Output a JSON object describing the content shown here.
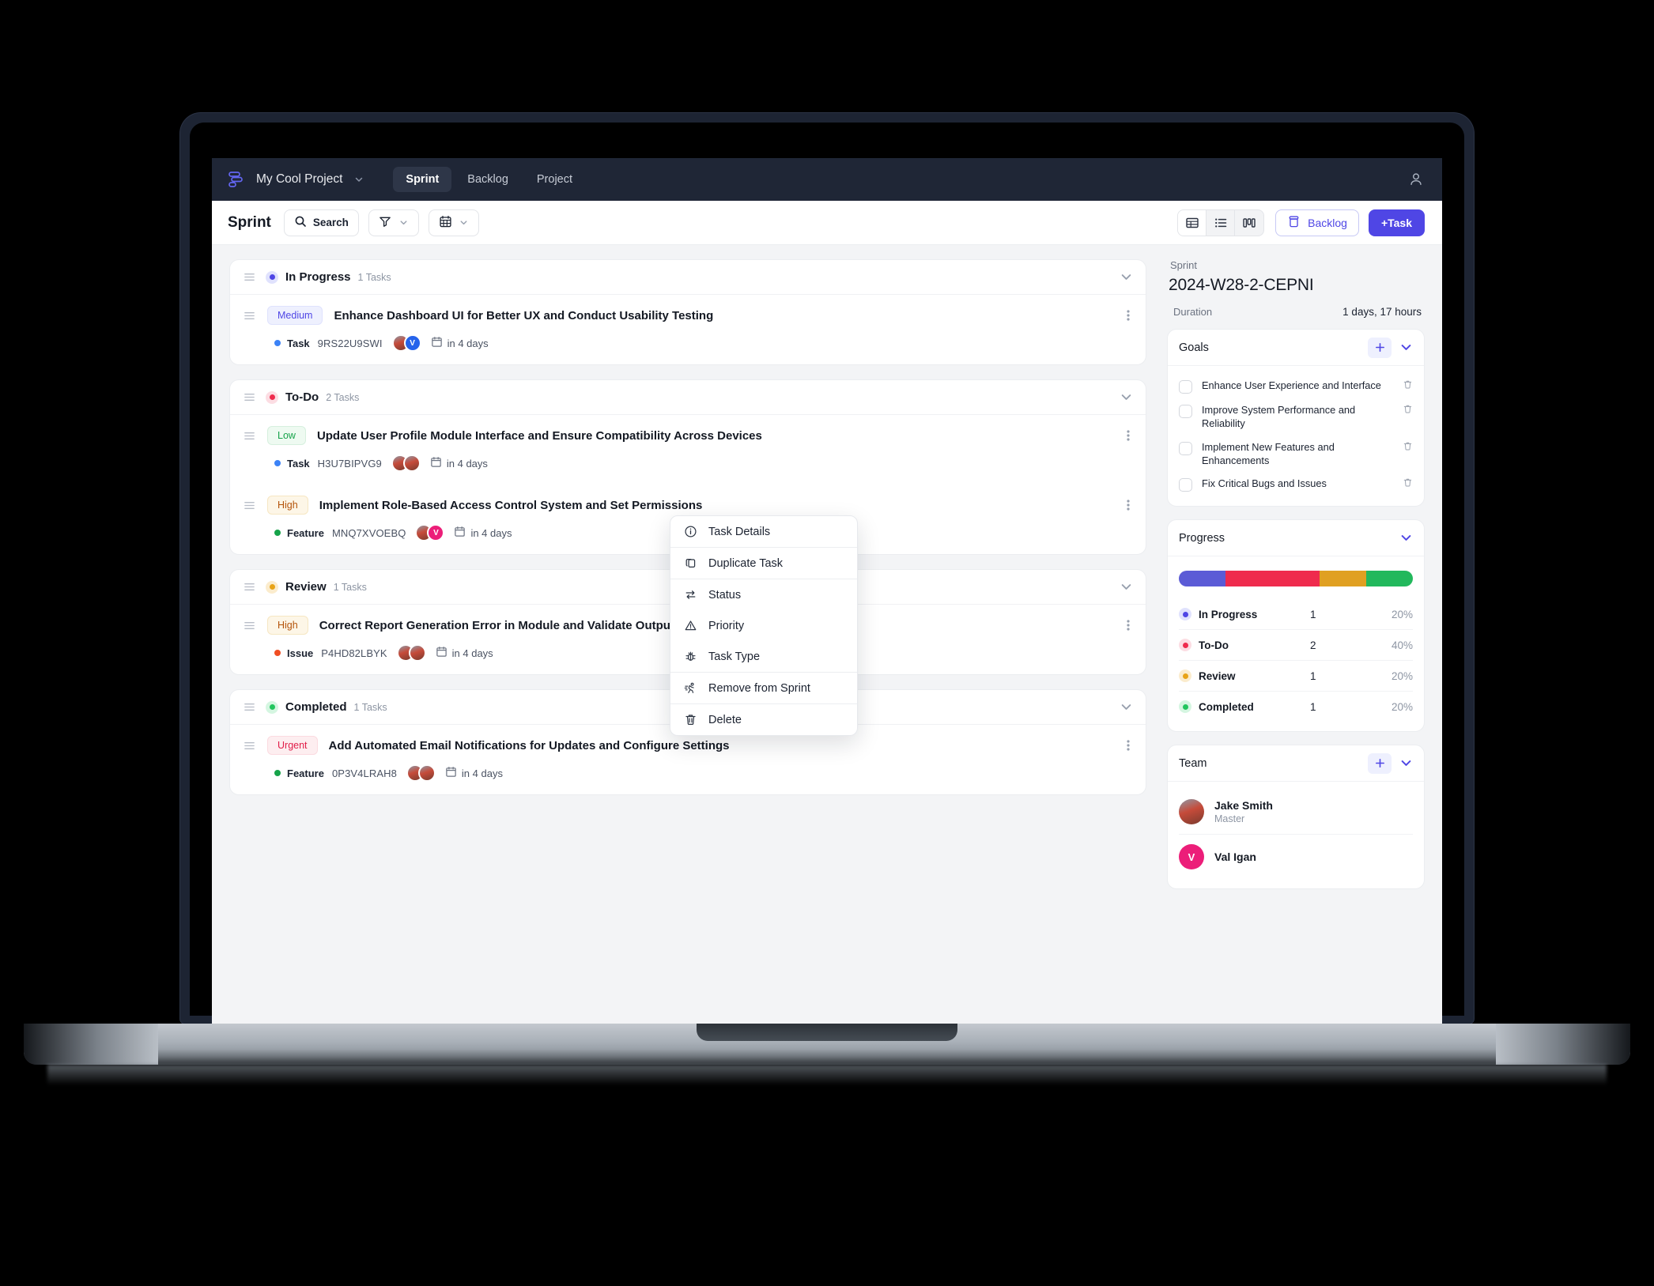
{
  "topbar": {
    "logo": "app-logo",
    "project_name": "My Cool Project",
    "nav": [
      {
        "label": "Sprint",
        "active": true
      },
      {
        "label": "Backlog",
        "active": false
      },
      {
        "label": "Project",
        "active": false
      }
    ],
    "user_icon": "user-icon"
  },
  "toolbar": {
    "title": "Sprint",
    "search_label": "Search",
    "filter_icon": "filter-icon",
    "calendar_icon": "calendar-icon",
    "views": [
      {
        "icon": "table-view-icon",
        "active": true
      },
      {
        "icon": "list-view-icon",
        "active": false
      },
      {
        "icon": "board-view-icon",
        "active": false
      }
    ],
    "backlog_label": "Backlog",
    "add_task_label": "+Task"
  },
  "groups": [
    {
      "name": "In Progress",
      "count_label": "1 Tasks",
      "color": "#4f46e5",
      "ring": "#e0e2fd",
      "tasks": [
        {
          "priority": "Medium",
          "priority_class": "medium",
          "title": "Enhance Dashboard UI for Better UX and Conduct Usability Testing",
          "type": "Task",
          "type_color": "#3b82f6",
          "id": "9RS22U9SWI",
          "avatars": [
            {
              "kind": "photo",
              "initial": ""
            },
            {
              "kind": "initial",
              "initial": "V",
              "color": "#2563eb"
            }
          ],
          "due": "in 4 days"
        }
      ]
    },
    {
      "name": "To-Do",
      "count_label": "2 Tasks",
      "color": "#ef2b4d",
      "ring": "#fcdde3",
      "tasks": [
        {
          "priority": "Low",
          "priority_class": "low",
          "title": "Update User Profile Module Interface and Ensure Compatibility Across Devices",
          "type": "Task",
          "type_color": "#3b82f6",
          "id": "H3U7BIPVG9",
          "avatars": [
            {
              "kind": "photo",
              "initial": ""
            },
            {
              "kind": "photo",
              "initial": ""
            }
          ],
          "due": "in 4 days"
        },
        {
          "priority": "High",
          "priority_class": "high",
          "title": "Implement Role-Based Access Control System and Set Permissions",
          "type": "Feature",
          "type_color": "#16a34a",
          "id": "MNQ7XVOEBQ",
          "avatars": [
            {
              "kind": "photo",
              "initial": ""
            },
            {
              "kind": "initial",
              "initial": "V",
              "color": "#ec1e79"
            }
          ],
          "due": "in 4 days"
        }
      ]
    },
    {
      "name": "Review",
      "count_label": "1 Tasks",
      "color": "#e8a317",
      "ring": "#fbeccd",
      "tasks": [
        {
          "priority": "High",
          "priority_class": "high",
          "title": "Correct Report Generation Error in Module and Validate Output Accuracy",
          "type": "Issue",
          "type_color": "#f04e23",
          "id": "P4HD82LBYK",
          "avatars": [
            {
              "kind": "photo",
              "initial": ""
            },
            {
              "kind": "photo",
              "initial": ""
            }
          ],
          "due": "in 4 days"
        }
      ]
    },
    {
      "name": "Completed",
      "count_label": "1 Tasks",
      "color": "#22c55e",
      "ring": "#d5f6e1",
      "tasks": [
        {
          "priority": "Urgent",
          "priority_class": "urgent",
          "title": "Add Automated Email Notifications for Updates and Configure Settings",
          "type": "Feature",
          "type_color": "#16a34a",
          "id": "0P3V4LRAH8",
          "avatars": [
            {
              "kind": "photo",
              "initial": ""
            },
            {
              "kind": "photo",
              "initial": ""
            }
          ],
          "due": "in 4 days"
        }
      ]
    }
  ],
  "context_menu": {
    "items": [
      {
        "label": "Task Details",
        "icon": "info-icon",
        "separator_after": true
      },
      {
        "label": "Duplicate Task",
        "icon": "copy-icon",
        "separator_after": true
      },
      {
        "label": "Status",
        "icon": "swap-icon",
        "separator_after": false
      },
      {
        "label": "Priority",
        "icon": "warning-icon",
        "separator_after": false
      },
      {
        "label": "Task Type",
        "icon": "bug-icon",
        "separator_after": true
      },
      {
        "label": "Remove from Sprint",
        "icon": "runner-icon",
        "separator_after": true
      },
      {
        "label": "Delete",
        "icon": "trash-icon",
        "separator_after": false
      }
    ]
  },
  "sidebar": {
    "sprint_label": "Sprint",
    "sprint_name": "2024-W28-2-CEPNI",
    "duration_label": "Duration",
    "duration_value": "1 days, 17 hours",
    "goals": {
      "title": "Goals",
      "items": [
        {
          "text": "Enhance User Experience and Interface"
        },
        {
          "text": "Improve System Performance and Reliability"
        },
        {
          "text": "Implement New Features and Enhancements"
        },
        {
          "text": "Fix Critical Bugs and Issues"
        }
      ]
    },
    "progress": {
      "title": "Progress",
      "segments": [
        {
          "color": "#5b5bd6",
          "percent": 20
        },
        {
          "color": "#ef2b4d",
          "percent": 40
        },
        {
          "color": "#e0a022",
          "percent": 20
        },
        {
          "color": "#22b85c",
          "percent": 20
        }
      ],
      "rows": [
        {
          "name": "In Progress",
          "count": "1",
          "percent": "20%",
          "color": "#4f46e5",
          "ring": "#e0e2fd"
        },
        {
          "name": "To-Do",
          "count": "2",
          "percent": "40%",
          "color": "#ef2b4d",
          "ring": "#fcdde3"
        },
        {
          "name": "Review",
          "count": "1",
          "percent": "20%",
          "color": "#e8a317",
          "ring": "#fbeccd"
        },
        {
          "name": "Completed",
          "count": "1",
          "percent": "20%",
          "color": "#22c55e",
          "ring": "#d5f6e1"
        }
      ]
    },
    "team": {
      "title": "Team",
      "members": [
        {
          "name": "Jake Smith",
          "role": "Master",
          "kind": "photo",
          "initial": "",
          "color": "#8a8f99"
        },
        {
          "name": "Val Igan",
          "role": "",
          "kind": "initial",
          "initial": "V",
          "color": "#ec1e79"
        }
      ]
    }
  }
}
